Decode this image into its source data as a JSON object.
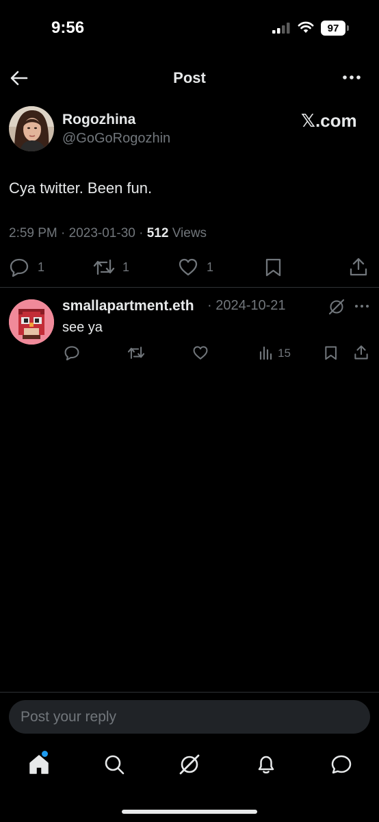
{
  "status_bar": {
    "time": "9:56",
    "battery": "97"
  },
  "header": {
    "title": "Post"
  },
  "post": {
    "author_name": "Rogozhina",
    "author_handle": "@GoGoRogozhin",
    "badge": "𝕏.com",
    "text": "Cya twitter. Been fun.",
    "timestamp": "2:59 PM · 2023-01-30 · ",
    "views_count": "512",
    "views_label": " Views",
    "replies": "1",
    "reposts": "1",
    "likes": "1"
  },
  "reply": {
    "author_name": "smallapartment.eth",
    "date": "· 2024-10-21",
    "text": "see ya",
    "views": "15"
  },
  "reply_box": {
    "placeholder": "Post your reply"
  },
  "colors": {
    "background": "#000000",
    "text": "#e7e9ea",
    "muted": "#71767b",
    "divider": "#2f3336",
    "notification_dot": "#1d9bf0"
  }
}
